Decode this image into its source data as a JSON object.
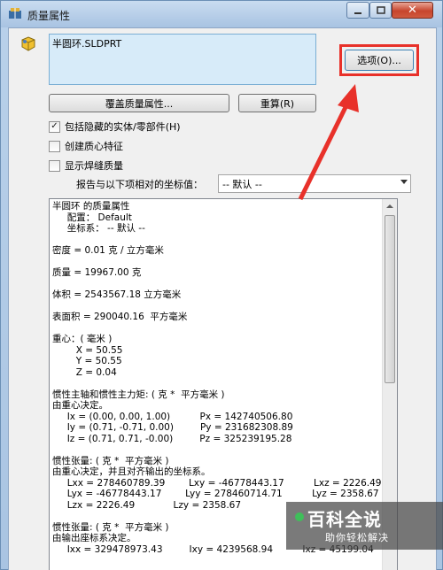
{
  "window": {
    "title": "质量属性"
  },
  "controls": {
    "close_glyph": "✕"
  },
  "list": {
    "items": [
      "半圆环.SLDPRT"
    ]
  },
  "buttons": {
    "options": "选项(O)...",
    "override": "覆盖质量属性...",
    "recalc": "重算(R)"
  },
  "checks": [
    {
      "label": "包括隐藏的实体/零部件(H)",
      "checked": true
    },
    {
      "label": "创建质心特征",
      "checked": false
    },
    {
      "label": "显示焊缝质量",
      "checked": false
    }
  ],
  "coord": {
    "label": "报告与以下项相对的坐标值：",
    "value": "-- 默认 --"
  },
  "report": {
    "lines": [
      "半圆环 的质量属性",
      "     配置： Default",
      "     坐标系： -- 默认 --",
      "",
      "密度 = 0.01 克 / 立方毫米",
      "",
      "质量 = 19967.00 克",
      "",
      "体积 = 2543567.18 立方毫米",
      "",
      "表面积 = 290040.16  平方毫米",
      "",
      "重心：( 毫米 )",
      "        X = 50.55",
      "        Y = 50.55",
      "        Z = 0.04",
      "",
      "惯性主轴和惯性主力矩: ( 克 *  平方毫米 )",
      "由重心决定。",
      "     Ix = (0.00, 0.00, 1.00)          Px = 142740506.80",
      "     Iy = (0.71, -0.71, 0.00)         Py = 231682308.89",
      "     Iz = (0.71, 0.71, -0.00)         Pz = 325239195.28",
      "",
      "惯性张量: ( 克 *  平方毫米 )",
      "由重心决定，并且对齐输出的坐标系。",
      "     Lxx = 278460789.39        Lxy = -46778443.17          Lxz = 2226.49",
      "     Lyx = -46778443.17        Lyy = 278460714.71          Lyz = 2358.67",
      "     Lzx = 2226.49             Lzy = 2358.67",
      "",
      "惯性张量: ( 克 *  平方毫米 )",
      "由输出座标系决定。",
      "     Ixx = 329478973.43         Ixy = 4239568.94          Ixz = 45199.04"
    ]
  },
  "watermark": {
    "logo": "百科全说",
    "sub": "助你轻松解决"
  },
  "colors": {
    "highlight": "#e8312a",
    "list_bg": "#d7ebf9"
  },
  "icons": [
    "app-icon",
    "mass-props-icon",
    "scroll-up-icon",
    "dropdown-arrow-icon"
  ]
}
